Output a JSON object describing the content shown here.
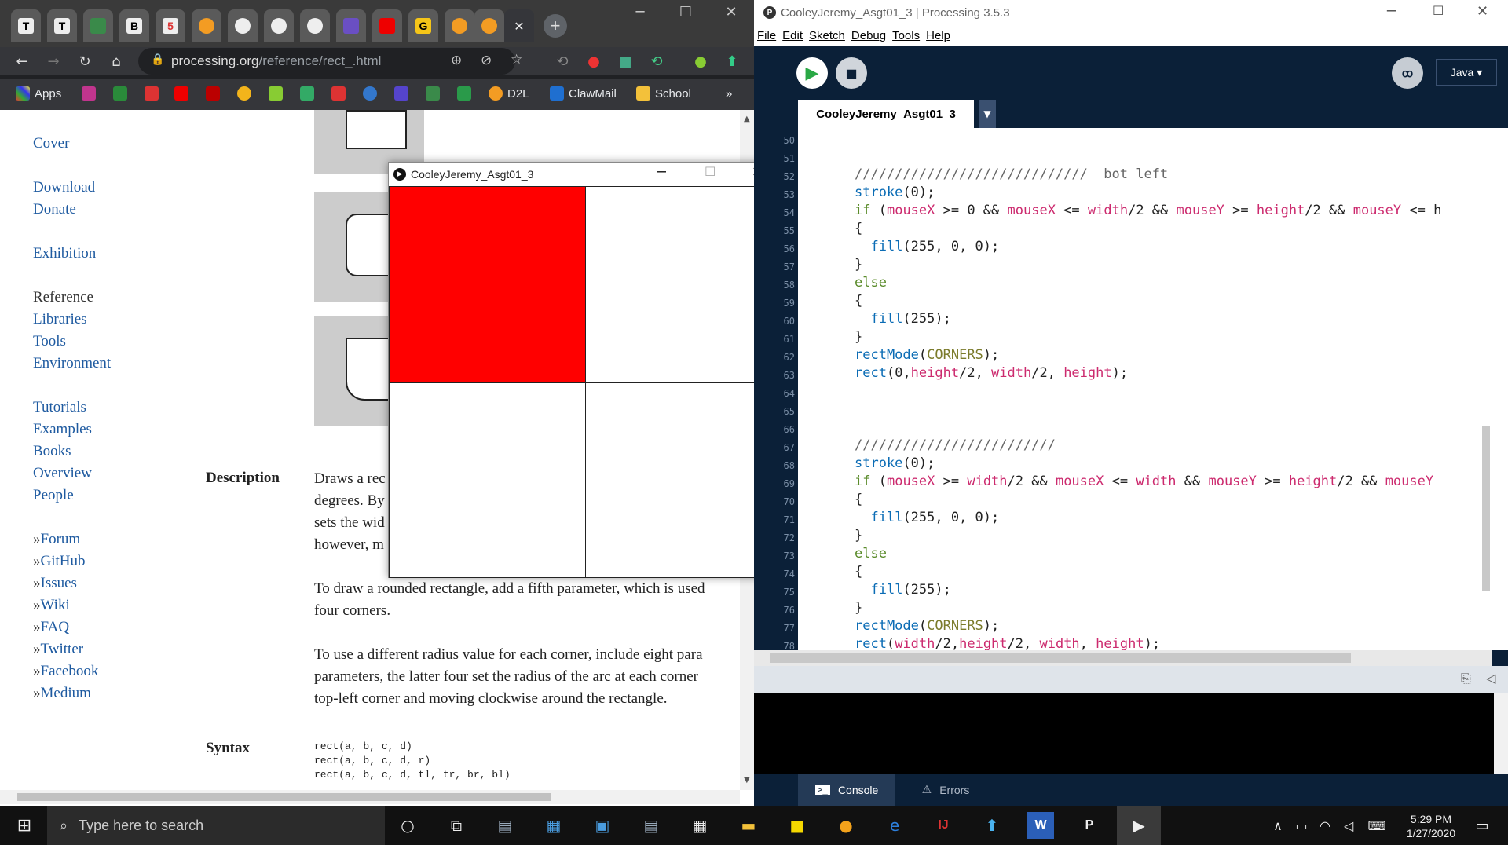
{
  "browser": {
    "url_main": "processing.org",
    "url_path": "/reference/rect_.html",
    "tabs": [
      "T",
      "T",
      "",
      "B",
      "5",
      "",
      "",
      "",
      "",
      "",
      "",
      "G",
      "",
      ""
    ],
    "bookmarks": [
      "Apps",
      "D2L",
      "ClawMail",
      "School"
    ],
    "more": "»"
  },
  "site": {
    "nav": [
      {
        "label": "Cover",
        "dark": false
      },
      {
        "label": "Download",
        "dark": false
      },
      {
        "label": "Donate",
        "dark": false
      },
      {
        "label": "Exhibition",
        "dark": false
      },
      {
        "label": "Reference",
        "dark": true
      },
      {
        "label": "Libraries",
        "dark": false
      },
      {
        "label": "Tools",
        "dark": false
      },
      {
        "label": "Environment",
        "dark": false
      },
      {
        "label": "Tutorials",
        "dark": false
      },
      {
        "label": "Examples",
        "dark": false
      },
      {
        "label": "Books",
        "dark": false
      },
      {
        "label": "Overview",
        "dark": false
      },
      {
        "label": "People",
        "dark": false
      }
    ],
    "ext_links": [
      "Forum",
      "GitHub",
      "Issues",
      "Wiki",
      "FAQ",
      "Twitter",
      "Facebook",
      "Medium"
    ],
    "arrow": "»",
    "description_label": "Description",
    "description_lines": [
      "Draws a rec",
      "degrees. By",
      "sets the wid",
      "however, m"
    ],
    "para2": [
      "To draw a rounded rectangle, add a fifth parameter, which is used",
      "four corners."
    ],
    "para3": [
      "To use a different radius value for each corner, include eight para",
      "parameters, the latter four set the radius of the arc at each corner",
      "top-left corner and moving clockwise around the rectangle."
    ],
    "syntax_label": "Syntax",
    "syntax": [
      "rect(a, b, c, d)",
      "rect(a, b, c, d, r)",
      "rect(a, b, c, d, tl, tr, br, bl)"
    ]
  },
  "sketch": {
    "title": "CooleyJeremy_Asgt01_3",
    "fill_color": "#ff0000"
  },
  "ide": {
    "title": "CooleyJeremy_Asgt01_3 | Processing 3.5.3",
    "menu": [
      "File",
      "Edit",
      "Sketch",
      "Debug",
      "Tools",
      "Help"
    ],
    "mode": "Java ▾",
    "tab": "CooleyJeremy_Asgt01_3",
    "line_numbers": [
      "50",
      "51",
      "52",
      "53",
      "54",
      "55",
      "56",
      "57",
      "58",
      "59",
      "60",
      "61",
      "62",
      "63",
      "64",
      "65",
      "66",
      "67",
      "68",
      "69",
      "70",
      "71",
      "72",
      "73",
      "74",
      "75",
      "76",
      "77",
      "78"
    ],
    "console_tab": "Console",
    "errors_tab": "Errors"
  },
  "taskbar": {
    "search_placeholder": "Type here to search",
    "time": "5:29 PM",
    "date": "1/27/2020"
  }
}
